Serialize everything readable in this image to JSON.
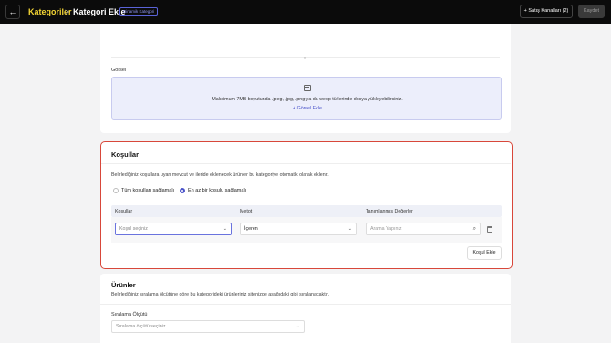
{
  "header": {
    "back_icon": "arrow-left-icon",
    "breadcrumb_root": "Kategoriler",
    "breadcrumb_separator": ">",
    "page_title": "Kategori Ekle",
    "badge": "Dinamik Kategori",
    "sales_channels_label": "+ Satış Kanalları (2)",
    "save_label": "Kaydet",
    "accent_color": "#f2d434"
  },
  "image_section": {
    "label": "Görsel",
    "upload_hint": "Maksimum 7MB boyutunda .jpeg, .jpg, .png ya da webp türlerinde dosya yükleyebilirsiniz.",
    "add_image_label": "+ Görsel Ekle",
    "icon": "image-icon"
  },
  "conditions": {
    "title": "Koşullar",
    "description": "Belirlediğiniz koşullara uyan mevcut ve ileride eklenecek ürünler bu kategoriye otomatik olarak eklenir.",
    "radio_all": "Tüm koşulları sağlamalı",
    "radio_any": "En az bir koşulu sağlamalı",
    "selected_radio": "En az bir koşulu sağlamalı",
    "columns": [
      "Koşullar",
      "Metot",
      "Tanımlanmış Değerler"
    ],
    "row": {
      "condition_placeholder": "Koşul seçiniz",
      "method_value": "İçeren",
      "value_placeholder": "Arama Yapınız"
    },
    "add_button": "Koşul Ekle",
    "highlight_color": "#d8473a"
  },
  "products": {
    "title": "Ürünler",
    "description": "Belirlediğiniz sıralama ölçütüne göre bu kategorideki ürünleriniz sitenizde aşağıdaki gibi sıralanacaktır.",
    "sort_label": "Sıralama Ölçütü",
    "sort_placeholder": "Sıralama ölçütü seçiniz"
  }
}
